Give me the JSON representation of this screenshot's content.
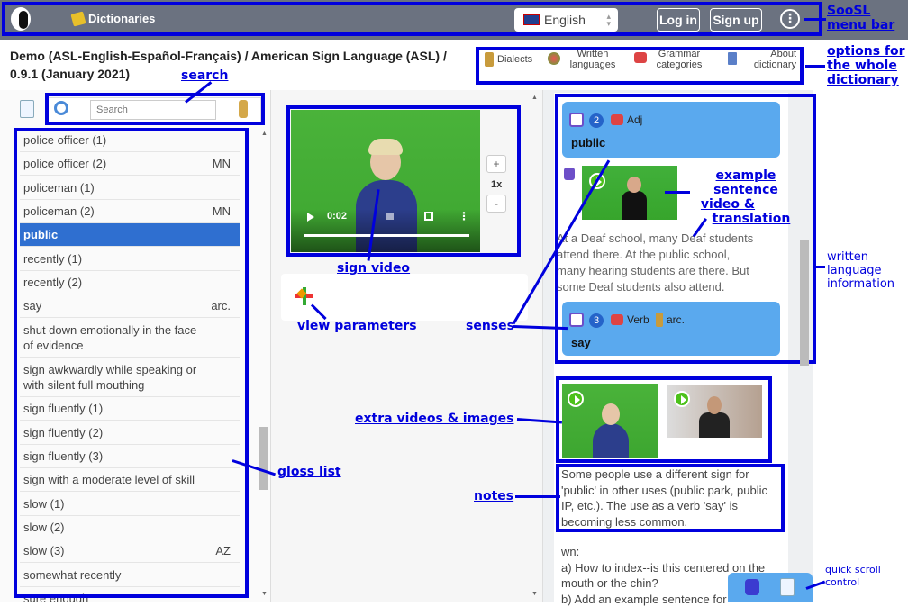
{
  "navbar": {
    "brand": "Dictionaries",
    "language": "English",
    "login": "Log in",
    "signup": "Sign up"
  },
  "title": {
    "line1": "Demo (ASL-English-Español-Français) / American Sign Language (ASL) /",
    "line2": "0.9.1 (January 2021)"
  },
  "options": {
    "dialects": "Dialects",
    "written_languages_1": "Written",
    "written_languages_2": "languages",
    "grammar_1": "Grammar",
    "grammar_2": "categories",
    "about_1": "About",
    "about_2": "dictionary"
  },
  "search": {
    "placeholder": "Search"
  },
  "gloss_list": [
    {
      "label": "police officer (1)",
      "tag": ""
    },
    {
      "label": "police officer (2)",
      "tag": "MN"
    },
    {
      "label": "policeman (1)",
      "tag": ""
    },
    {
      "label": "policeman (2)",
      "tag": "MN"
    },
    {
      "label": "public",
      "tag": ""
    },
    {
      "label": "recently (1)",
      "tag": ""
    },
    {
      "label": "recently (2)",
      "tag": ""
    },
    {
      "label": "say",
      "tag": "arc."
    },
    {
      "label1": "shut down emotionally in the face",
      "label2": "of evidence"
    },
    {
      "label1": "sign awkwardly while speaking or",
      "label2": "with silent full mouthing"
    },
    {
      "label": "sign fluently (1)",
      "tag": ""
    },
    {
      "label": "sign fluently (2)",
      "tag": ""
    },
    {
      "label": "sign fluently (3)",
      "tag": ""
    },
    {
      "label": "sign with a moderate level of skill",
      "tag": ""
    },
    {
      "label": "slow (1)",
      "tag": ""
    },
    {
      "label": "slow (2)",
      "tag": ""
    },
    {
      "label": "slow (3)",
      "tag": "AZ"
    },
    {
      "label": "somewhat recently",
      "tag": ""
    },
    {
      "label": "sure enough",
      "tag": ""
    }
  ],
  "video": {
    "time": "0:02",
    "speed": "1x",
    "plus": "+",
    "minus": "-"
  },
  "senses": [
    {
      "num": "2",
      "pos": "Adj",
      "word": "public"
    },
    {
      "num": "3",
      "pos": "Verb",
      "extra": "arc.",
      "word": "say"
    }
  ],
  "example_translation": [
    "At a Deaf school, many Deaf students",
    "attend there. At the public school,",
    "many hearing students are there. But",
    "some Deaf students also attend."
  ],
  "notes": [
    "Some people use a different sign for",
    "'public' in other uses (public park, public",
    "IP, etc.). The use as a verb 'say' is",
    "becoming less common."
  ],
  "extra_notes": [
    "wn:",
    "a) How to index--is this centered on the",
    "mouth or the chin?",
    "b) Add an example sentence for"
  ],
  "annotations": {
    "soosl_1": "SooSL",
    "soosl_2": "menu bar",
    "options_1": "options for",
    "options_2": "the whole",
    "options_3": "dictionary",
    "search": "search",
    "sign_video": "sign video",
    "view_parameters": "view parameters",
    "example_1": "example sentence",
    "example_2": "video &",
    "example_3": "translation",
    "written_1": "written",
    "written_2": "language",
    "written_3": "information",
    "senses": "senses",
    "extra_videos": "extra videos & images",
    "notes": "notes",
    "gloss_list": "gloss list",
    "quick_1": "quick scroll",
    "quick_2": "control"
  },
  "colors": {
    "navbar": "#6b7280",
    "annotation": "#0000dd",
    "sense_bg": "#5aa9ee",
    "active_row": "#2f6fd0",
    "video_green": "#45ad36"
  }
}
